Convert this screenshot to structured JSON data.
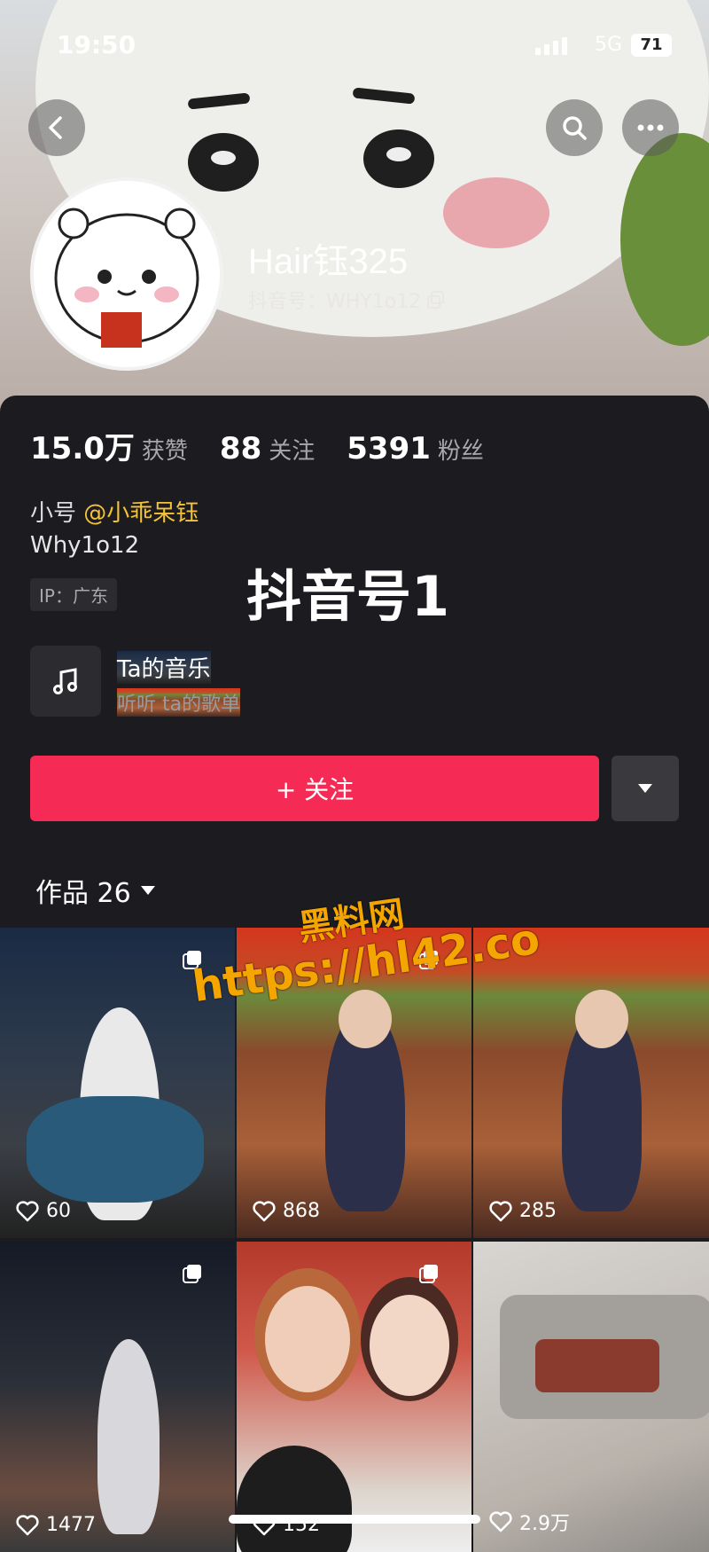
{
  "status_bar": {
    "time": "19:50",
    "network": "5G",
    "battery": "71"
  },
  "profile": {
    "name": "Hair钰325",
    "douyin_id": "抖音号：WHY1o12",
    "stats": [
      {
        "value": "15.0万",
        "label": "获赞"
      },
      {
        "value": "88",
        "label": "关注"
      },
      {
        "value": "5391",
        "label": "粉丝"
      }
    ],
    "alt_account_prefix": "小号",
    "alt_account_link": "@小乖呆钰",
    "bio": "Why1o12",
    "ip": "IP：广东",
    "overlay_caption": "抖音号1"
  },
  "music": {
    "title": "Ta的音乐",
    "subtitle": "听听 ta的歌单"
  },
  "actions": {
    "follow_label": "+ 关注"
  },
  "works": {
    "label": "作品 26"
  },
  "videos": [
    {
      "likes": "60"
    },
    {
      "likes": "868"
    },
    {
      "likes": "285"
    },
    {
      "likes": "1477"
    },
    {
      "likes": "152"
    },
    {
      "likes": "2.9万"
    }
  ],
  "watermark": {
    "line1": "黑料网",
    "line2": "https://hl42.co"
  },
  "icons": [
    "back-icon",
    "search-icon",
    "more-icon",
    "copy-icon",
    "music-note-icon",
    "dropdown-triangle-icon",
    "heart-icon",
    "multi-image-icon"
  ]
}
